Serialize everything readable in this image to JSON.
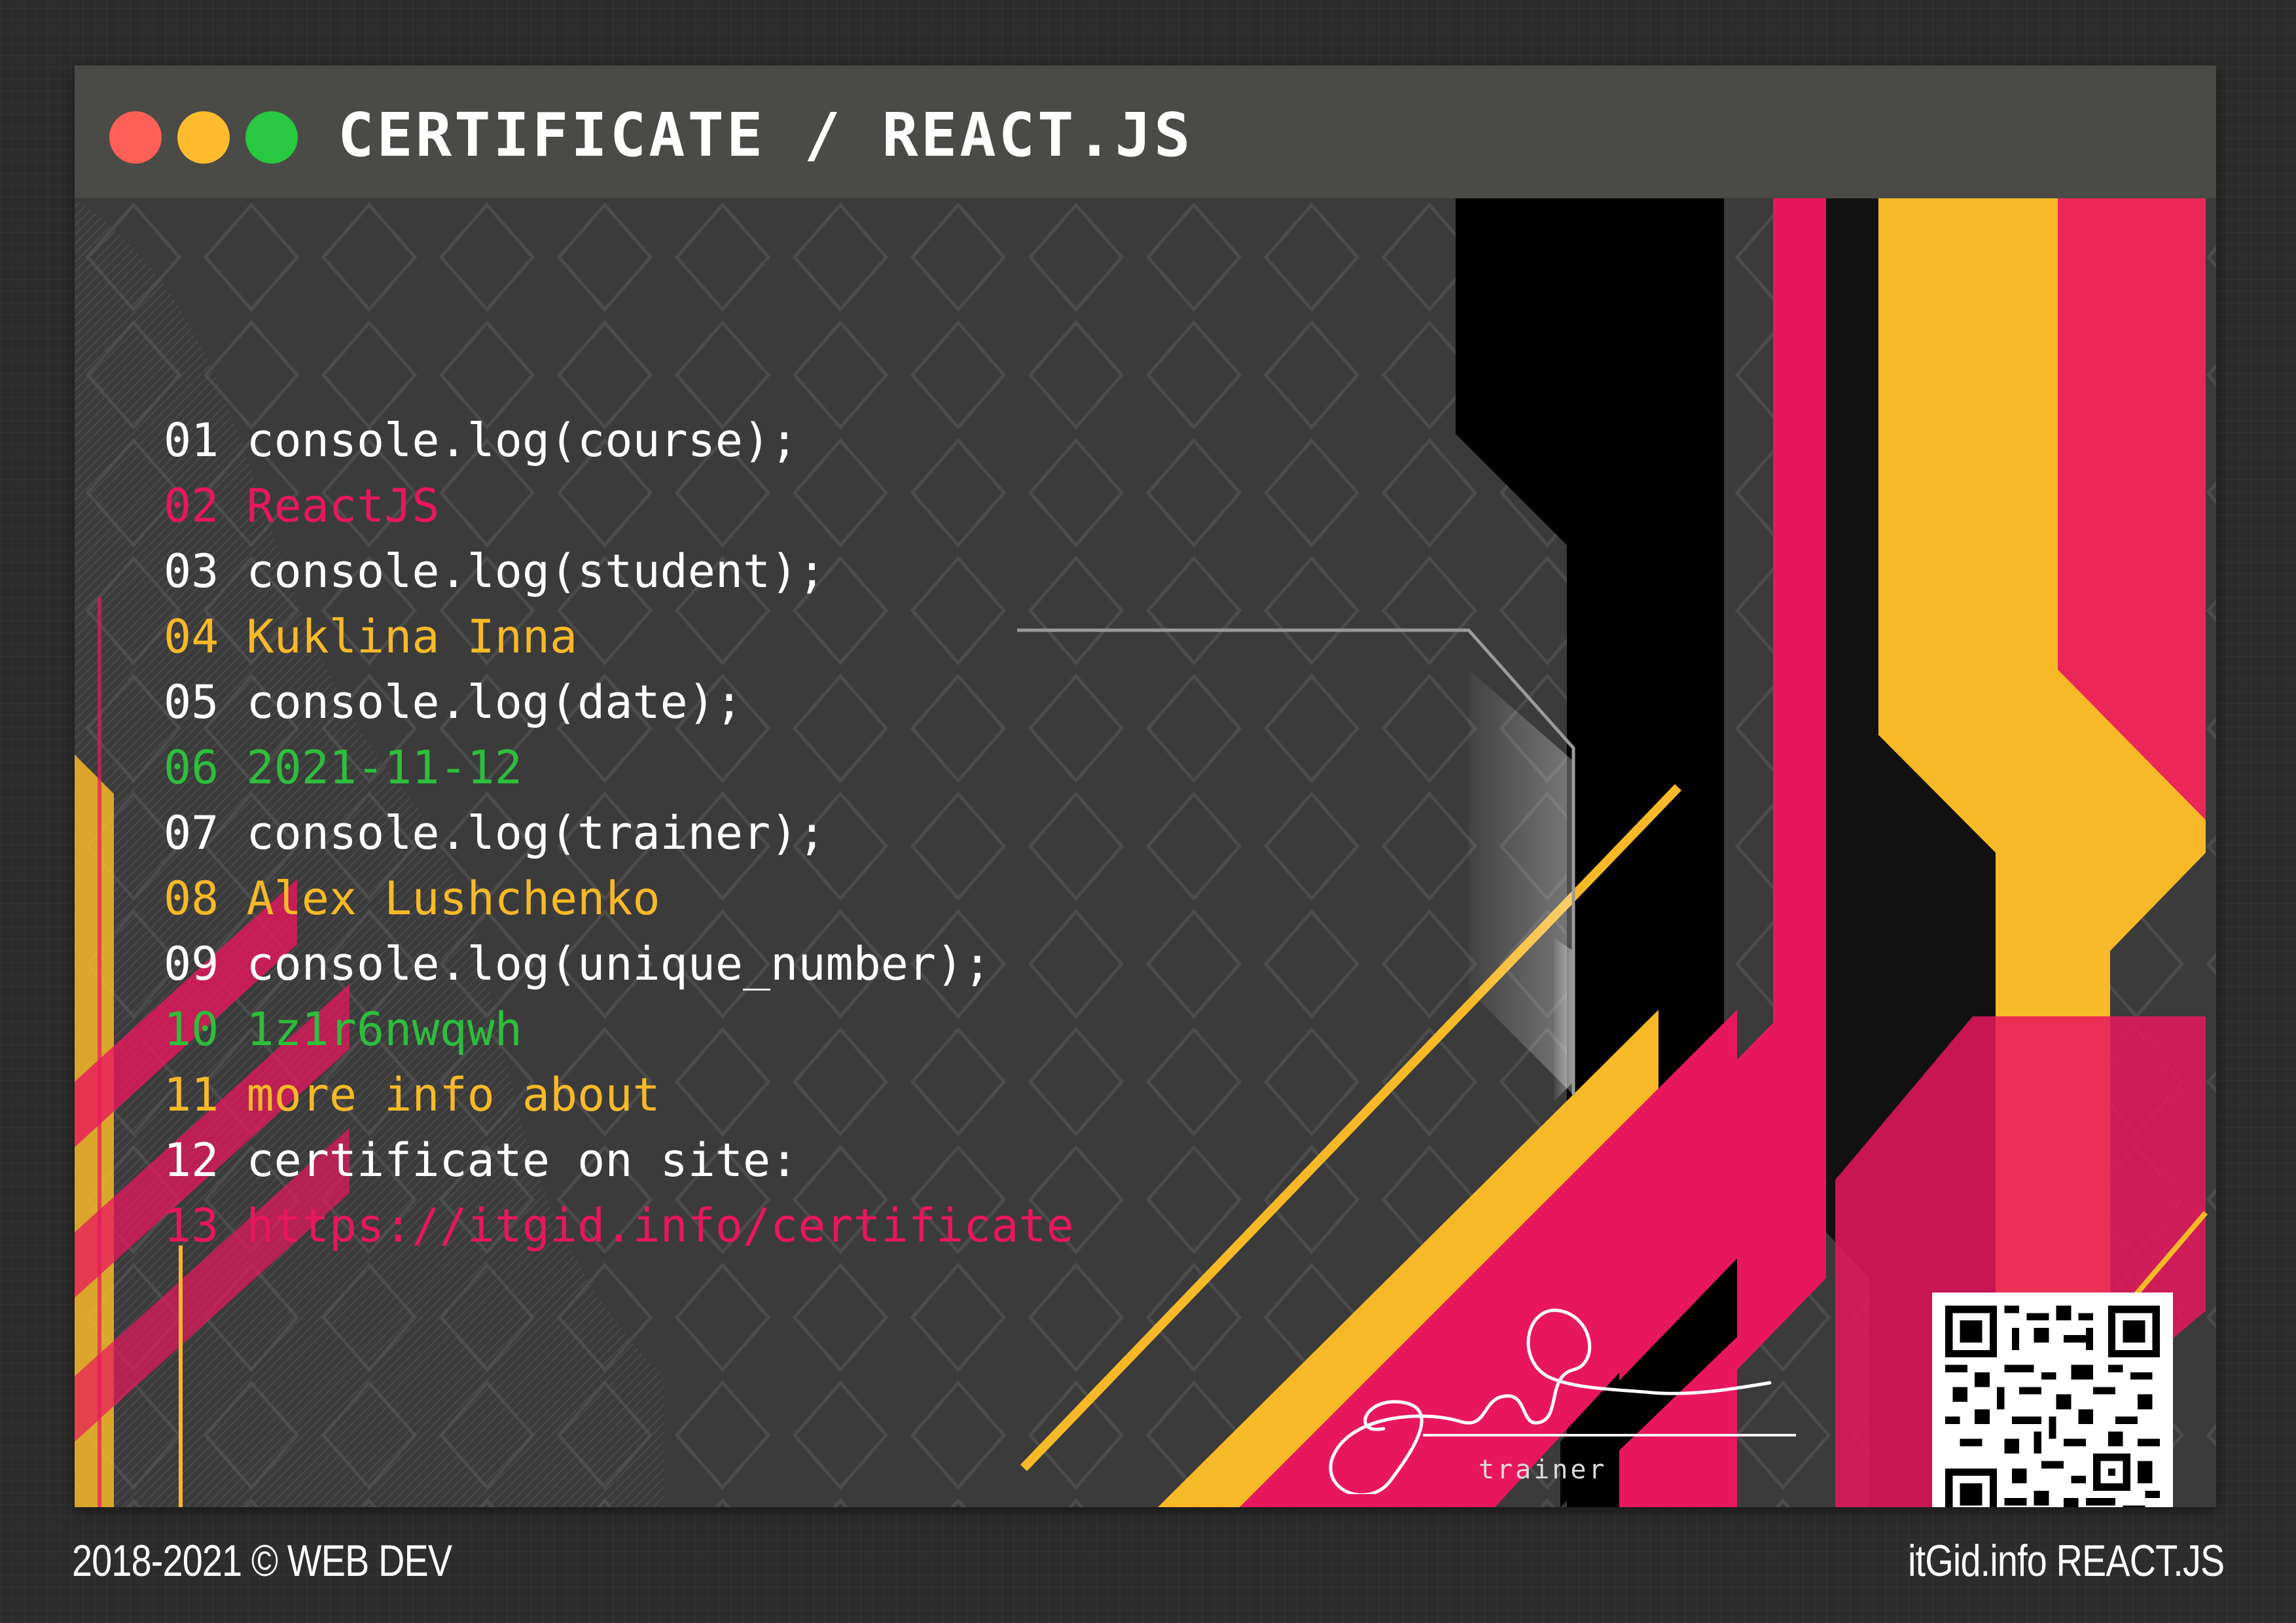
{
  "window": {
    "title": "CERTIFICATE / REACT.JS",
    "controls": [
      "close",
      "minimize",
      "maximize"
    ]
  },
  "code_lines": [
    {
      "num": "01",
      "text": "console.log(course);",
      "color": "#ffffff"
    },
    {
      "num": "02",
      "text": "ReactJS",
      "color": "#e8175d"
    },
    {
      "num": "03",
      "text": "console.log(student);",
      "color": "#ffffff"
    },
    {
      "num": "04",
      "text": "Kuklina Inna",
      "color": "#f7b928"
    },
    {
      "num": "05",
      "text": "console.log(date);",
      "color": "#ffffff"
    },
    {
      "num": "06",
      "text": "2021-11-12",
      "color": "#2dbe3c"
    },
    {
      "num": "07",
      "text": "console.log(trainer);",
      "color": "#ffffff"
    },
    {
      "num": "08",
      "text": "Alex Lushchenko",
      "color": "#f7b928"
    },
    {
      "num": "09",
      "text": "console.log(unique_number);",
      "color": "#ffffff"
    },
    {
      "num": "10",
      "text": "1z1r6nwqwh",
      "color": "#2dbe3c"
    },
    {
      "num": "11",
      "text": "more info about",
      "color": "#f7b928"
    },
    {
      "num": "12",
      "text": "certificate on site:",
      "color": "#ffffff"
    },
    {
      "num": "13",
      "text": "https://itgid.info/certificate",
      "color": "#e8175d"
    }
  ],
  "signature": {
    "label": "trainer"
  },
  "footer": {
    "left": "2018-2021 © WEB DEV",
    "right": "itGid.info REACT.JS"
  },
  "colors": {
    "pink": "#e8175d",
    "yellow": "#f7b928",
    "green": "#2dbe3c",
    "titlebar": "#4a4a46",
    "background": "#2c2c2c"
  }
}
